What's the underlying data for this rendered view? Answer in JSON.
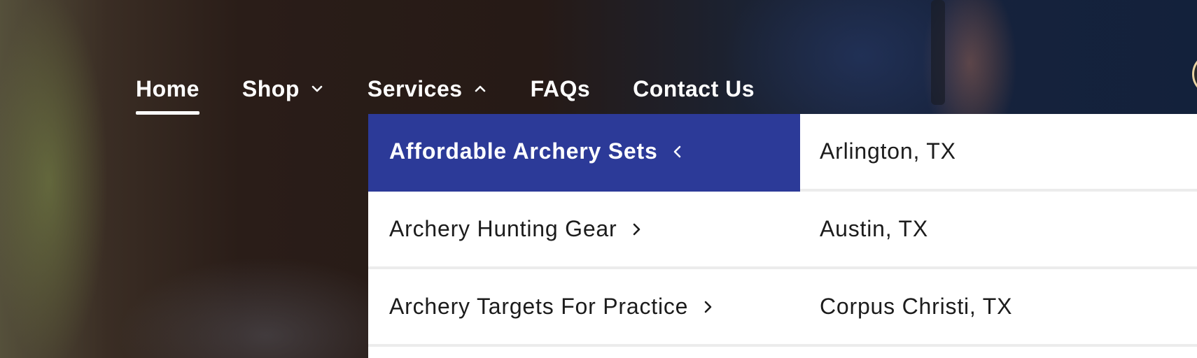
{
  "nav": {
    "items": [
      {
        "label": "Home",
        "active": true
      },
      {
        "label": "Shop",
        "chevron": "chevron-down"
      },
      {
        "label": "Services",
        "chevron": "chevron-up"
      },
      {
        "label": "FAQs"
      },
      {
        "label": "Contact Us"
      }
    ]
  },
  "dropdown": {
    "categories": [
      {
        "label": "Affordable Archery Sets",
        "selected": true,
        "chevron": "chevron-left"
      },
      {
        "label": "Archery Hunting Gear",
        "chevron": "chevron-right"
      },
      {
        "label": "Archery Targets For Practice",
        "chevron": "chevron-right"
      }
    ],
    "locations": [
      {
        "label": "Arlington, TX"
      },
      {
        "label": "Austin, TX"
      },
      {
        "label": "Corpus Christi, TX"
      }
    ]
  },
  "colors": {
    "accent": "#2c3a98",
    "nav_text": "#ffffff",
    "menu_bg": "#ffffff",
    "menu_text": "#1c1c1c"
  }
}
